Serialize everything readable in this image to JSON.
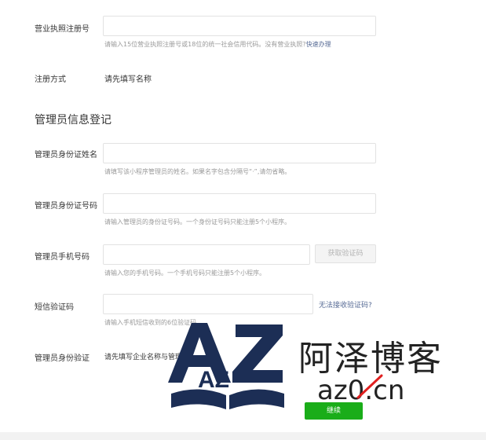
{
  "form": {
    "license": {
      "label": "营业执照注册号",
      "value": "",
      "hint": "请输入15位营业执照注册号或18位的统一社会信用代码。没有营业执照?",
      "hint_link": "快速办理"
    },
    "register_method": {
      "label": "注册方式",
      "value": "请先填写名称"
    }
  },
  "admin": {
    "section_title": "管理员信息登记",
    "name": {
      "label": "管理员身份证姓名",
      "value": "",
      "hint": "请填写该小程序管理员的姓名。如果名字包含分隔号“·”,请勿省略。"
    },
    "id_number": {
      "label": "管理员身份证号码",
      "value": "",
      "hint": "请输入管理员的身份证号码。一个身份证号码只能注册5个小程序。"
    },
    "phone": {
      "label": "管理员手机号码",
      "value": "",
      "hint": "请输入您的手机号码。一个手机号码只能注册5个小程序。",
      "code_button": "获取验证码"
    },
    "sms": {
      "label": "短信验证码",
      "value": "",
      "hint": "请输入手机短信收到的6位验证码",
      "link": "无法接收验证码?"
    },
    "verify": {
      "label": "管理员身份验证",
      "value": "请先填写企业名称与管理员身份信息"
    }
  },
  "submit_label": "继续",
  "watermark": {
    "logo": "AZ",
    "cn": "阿泽博客",
    "url": "az0.cn"
  },
  "colors": {
    "primary_green": "#1aad19",
    "link_blue": "#576b95",
    "border": "#e2e2e2",
    "hint": "#9a9a9a",
    "watermark_navy": "#1c2e55"
  }
}
